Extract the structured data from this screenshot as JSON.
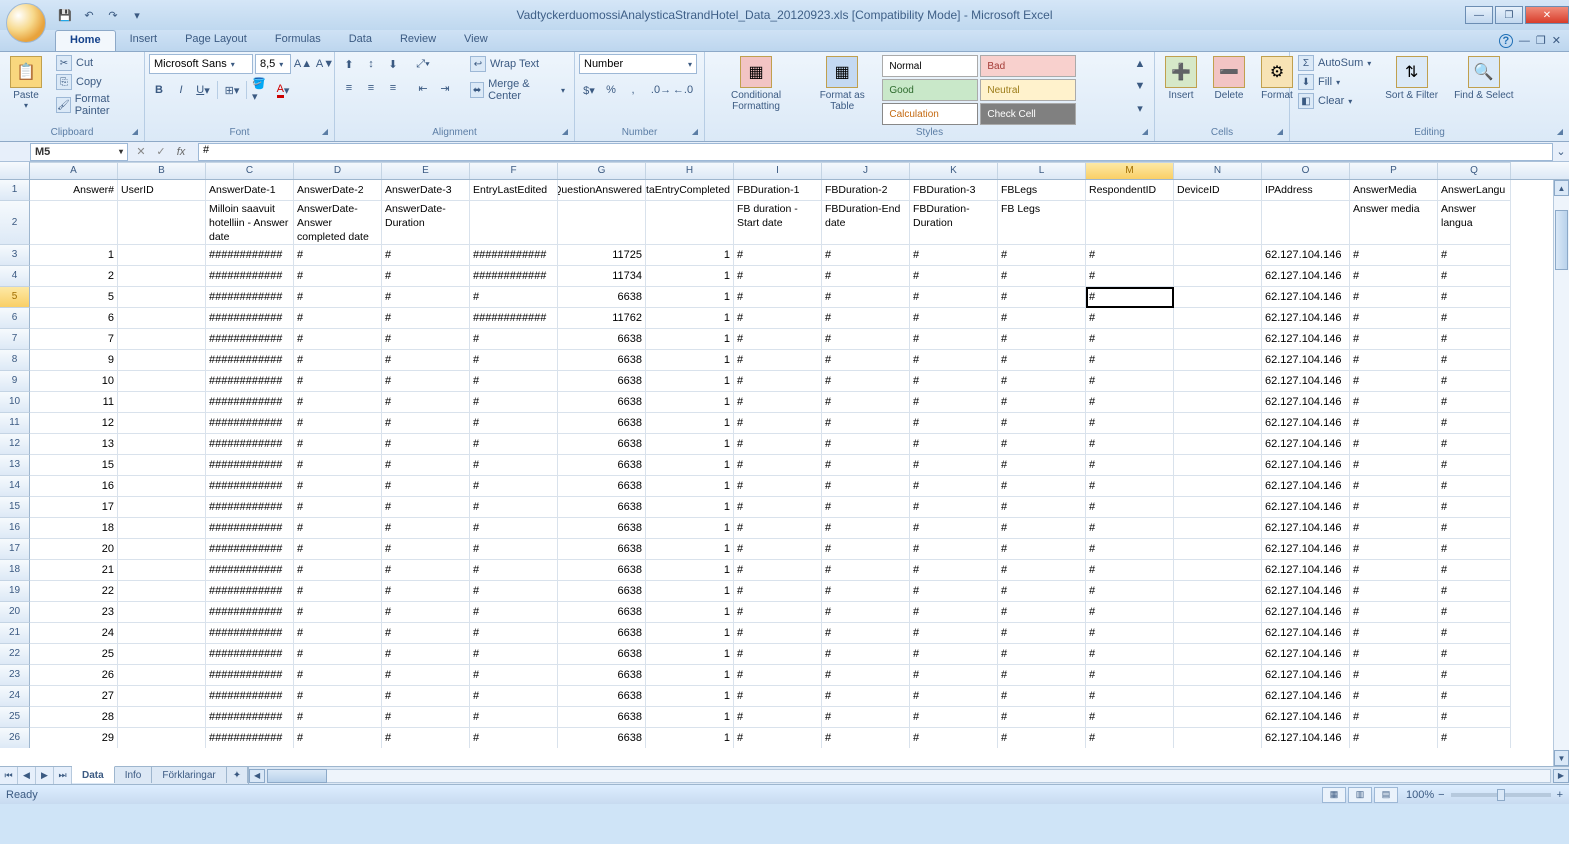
{
  "title": "VadtyckerduomossiAnalysticaStrandHotel_Data_20120923.xls  [Compatibility Mode] - Microsoft Excel",
  "tabs": [
    "Home",
    "Insert",
    "Page Layout",
    "Formulas",
    "Data",
    "Review",
    "View"
  ],
  "active_tab": "Home",
  "clipboard": {
    "paste": "Paste",
    "cut": "Cut",
    "copy": "Copy",
    "format_painter": "Format Painter",
    "label": "Clipboard"
  },
  "font": {
    "name": "Microsoft Sans",
    "size": "8,5",
    "label": "Font"
  },
  "alignment": {
    "wrap": "Wrap Text",
    "merge": "Merge & Center",
    "label": "Alignment"
  },
  "number": {
    "format": "Number",
    "label": "Number"
  },
  "styles": {
    "cond": "Conditional Formatting",
    "table": "Format as Table",
    "normal": "Normal",
    "bad": "Bad",
    "good": "Good",
    "neutral": "Neutral",
    "calc": "Calculation",
    "check": "Check Cell",
    "label": "Styles"
  },
  "cells": {
    "insert": "Insert",
    "delete": "Delete",
    "format": "Format",
    "label": "Cells"
  },
  "editing": {
    "autosum": "AutoSum",
    "fill": "Fill",
    "clear": "Clear",
    "sort": "Sort & Filter",
    "find": "Find & Select",
    "label": "Editing"
  },
  "namebox": "M5",
  "formula": "#",
  "columns": [
    "A",
    "B",
    "C",
    "D",
    "E",
    "F",
    "G",
    "H",
    "I",
    "J",
    "K",
    "L",
    "M",
    "N",
    "O",
    "P",
    "Q"
  ],
  "headers1": [
    "Answer#",
    "UserID",
    "AnswerDate-1",
    "AnswerDate-2",
    "AnswerDate-3",
    "EntryLastEdited",
    "LastQuestionAnswered",
    "DataEntryCompleted",
    "FBDuration-1",
    "FBDuration-2",
    "FBDuration-3",
    "FBLegs",
    "RespondentID",
    "DeviceID",
    "IPAddress",
    "AnswerMedia",
    "AnswerLangu"
  ],
  "headers2": [
    "",
    "",
    "Milloin saavuit hotelliin - Answer date",
    "AnswerDate-Answer completed date",
    "AnswerDate-Duration",
    "",
    "",
    "",
    "FB duration - Start date",
    "FBDuration-End date",
    "FBDuration-Duration",
    "FB Legs",
    "",
    "",
    "",
    "Answer media",
    "Answer langua"
  ],
  "row_ids": [
    1,
    2,
    5,
    6,
    7,
    9,
    10,
    11,
    12,
    13,
    15,
    16,
    17,
    18,
    20,
    21,
    22,
    23,
    24,
    25,
    26,
    27,
    28,
    29
  ],
  "first_g": [
    11725,
    11734,
    6638,
    11762
  ],
  "first_f": [
    "############",
    "############",
    "#",
    "############"
  ],
  "default_g": 6638,
  "ip": "62.127.104.146",
  "hash_long": "############",
  "hash": "#",
  "one": "1",
  "sheet_tabs": [
    "Data",
    "Info",
    "Förklaringar"
  ],
  "active_sheet": "Data",
  "status": "Ready",
  "zoom": "100%",
  "selected_cell": {
    "row": 5,
    "col": "M"
  }
}
